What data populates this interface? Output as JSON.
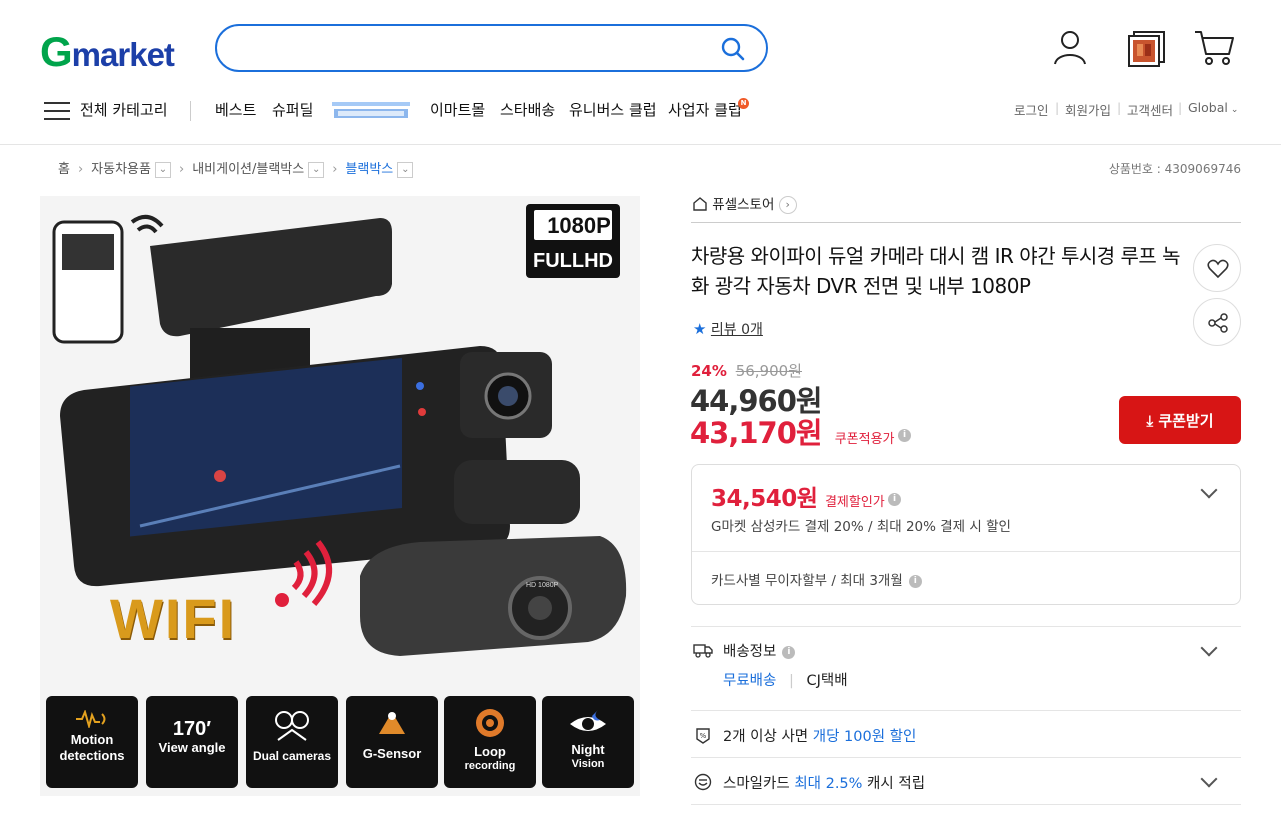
{
  "header": {
    "logo": {
      "g": "G",
      "rest": "market"
    },
    "search": {
      "placeholder": ""
    },
    "nav": {
      "all_categories": "전체 카테고리",
      "items": [
        "베스트",
        "슈퍼딜",
        "이마트몰",
        "스타배송",
        "유니버스 클럽",
        "사업자 클럽"
      ],
      "badge": "N"
    },
    "util": [
      "로그인",
      "회원가입",
      "고객센터",
      "Global"
    ]
  },
  "breadcrumb": [
    "홈",
    "자동차용품",
    "내비게이션/블랙박스",
    "블랙박스"
  ],
  "product_no": "상품번호 : 4309069746",
  "image": {
    "badge_top": "1080P",
    "badge_bottom": "FULLHD",
    "wifi_text": "WIFI",
    "features": [
      {
        "line1": "Motion",
        "line2": "detections"
      },
      {
        "line1": "170′",
        "line2": "View angle"
      },
      {
        "line1": "",
        "line2": "Dual cameras"
      },
      {
        "line1": "",
        "line2": "G-Sensor"
      },
      {
        "line1": "Loop",
        "line2": "recording"
      },
      {
        "line1": "Night",
        "line2": "Vision"
      }
    ],
    "cam_label": "HD 1080P"
  },
  "store": "퓨셀스토어",
  "product": {
    "title": "차량용 와이파이 듀얼 카메라 대시 캠 IR 야간 투시경 루프 녹화 광각 자동차 DVR 전면 및 내부 1080P",
    "review": "리뷰 0개",
    "discount_pct": "24%",
    "original_price": "56,900원",
    "price": "44,960원",
    "coupon_price": "43,170원",
    "coupon_label": "쿠폰적용가",
    "coupon_button": "쿠폰받기"
  },
  "payment": {
    "price": "34,540원",
    "label": "결제할인가",
    "desc": "G마켓 삼성카드 결제 20% / 최대 20% 결제 시 할인",
    "installment": "카드사별 무이자할부 / 최대 3개월"
  },
  "shipping": {
    "label": "배송정보",
    "free": "무료배송",
    "carrier": "CJ택배"
  },
  "multi_discount": {
    "pre": "2개 이상 사면 ",
    "highlight": "개당 100원 할인"
  },
  "smilecard": {
    "pre": "스마일카드 ",
    "highlight": "최대 2.5%",
    "post": " 캐시 적립"
  },
  "colors": {
    "accent_blue": "#1b6fdb",
    "sale_red": "#e0203c",
    "coupon_red": "#d71515",
    "logo_green": "#00a44b"
  }
}
